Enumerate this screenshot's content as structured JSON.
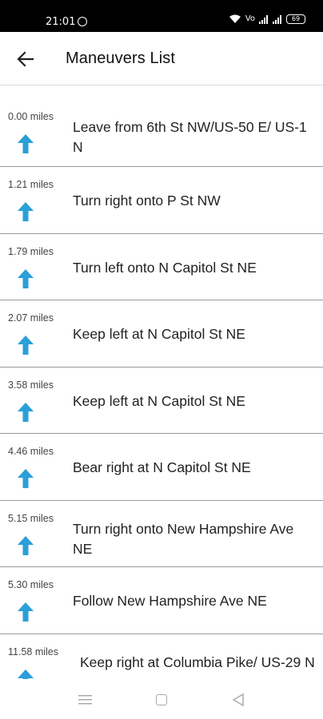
{
  "status_bar": {
    "time": "21:01",
    "volte_label": "Vo",
    "battery_level": "69"
  },
  "header": {
    "title": "Maneuvers List",
    "back_icon": "arrow-left-icon"
  },
  "accent_color": "#2a9fd8",
  "maneuvers": [
    {
      "distance": "0.00 miles",
      "instruction": "Leave from 6th St NW/US-50 E/ US-1 N",
      "icon": "straight-arrow-icon"
    },
    {
      "distance": "1.21 miles",
      "instruction": "Turn right onto P St NW",
      "icon": "straight-arrow-icon"
    },
    {
      "distance": "1.79 miles",
      "instruction": "Turn left onto N Capitol St NE",
      "icon": "straight-arrow-icon"
    },
    {
      "distance": "2.07 miles",
      "instruction": "Keep left at N Capitol St NE",
      "icon": "straight-arrow-icon"
    },
    {
      "distance": "3.58 miles",
      "instruction": "Keep left at N Capitol St NE",
      "icon": "straight-arrow-icon"
    },
    {
      "distance": "4.46 miles",
      "instruction": "Bear right at N Capitol St NE",
      "icon": "straight-arrow-icon"
    },
    {
      "distance": "5.15 miles",
      "instruction": "Turn right onto New Hampshire Ave NE",
      "icon": "straight-arrow-icon"
    },
    {
      "distance": "5.30 miles",
      "instruction": "Follow New Hampshire Ave NE",
      "icon": "straight-arrow-icon"
    },
    {
      "distance": "11.58 miles",
      "instruction": "Keep right at Columbia Pike/ US-29 N",
      "icon": "straight-arrow-icon"
    }
  ]
}
